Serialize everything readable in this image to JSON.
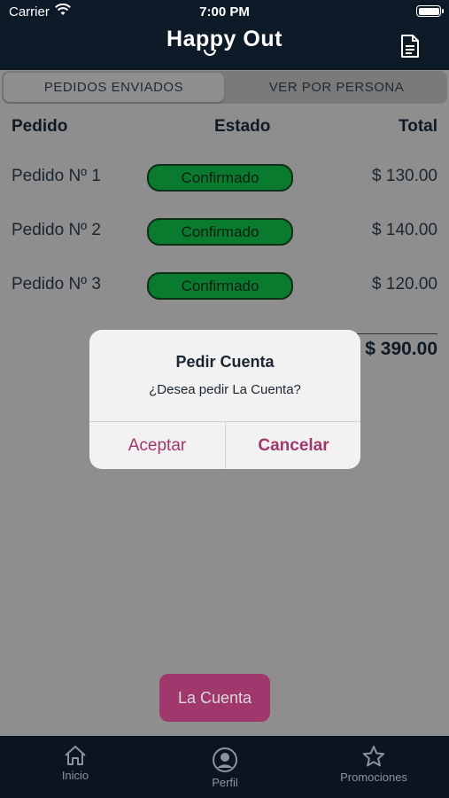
{
  "status_bar": {
    "carrier": "Carrier",
    "time": "7:00 PM"
  },
  "header": {
    "logo": "Happy Out",
    "doc_icon": "document-icon"
  },
  "segments": [
    {
      "label": "PEDIDOS ENVIADOS",
      "selected": true
    },
    {
      "label": "VER POR PERSONA",
      "selected": false
    }
  ],
  "table": {
    "headers": {
      "pedido": "Pedido",
      "estado": "Estado",
      "total": "Total"
    },
    "rows": [
      {
        "name": "Pedido Nº 1",
        "status": "Confirmado",
        "total": "$ 130.00"
      },
      {
        "name": "Pedido Nº 2",
        "status": "Confirmado",
        "total": "$ 140.00"
      },
      {
        "name": "Pedido Nº 3",
        "status": "Confirmado",
        "total": "$ 120.00"
      }
    ],
    "grand_total": "$ 390.00"
  },
  "bottom_button": "La Cuenta",
  "alert": {
    "title": "Pedir Cuenta",
    "message": "¿Desea pedir La Cuenta?",
    "accept": "Aceptar",
    "cancel": "Cancelar"
  },
  "tabbar": {
    "items": [
      {
        "label": "Inicio",
        "icon": "home-icon"
      },
      {
        "label": "Perfil",
        "icon": "user-circle-icon"
      },
      {
        "label": "Promociones",
        "icon": "star-icon"
      }
    ]
  },
  "colors": {
    "header_bg": "#0d1a27",
    "accent": "#a0386d",
    "status_green": "#0a7a2e"
  }
}
